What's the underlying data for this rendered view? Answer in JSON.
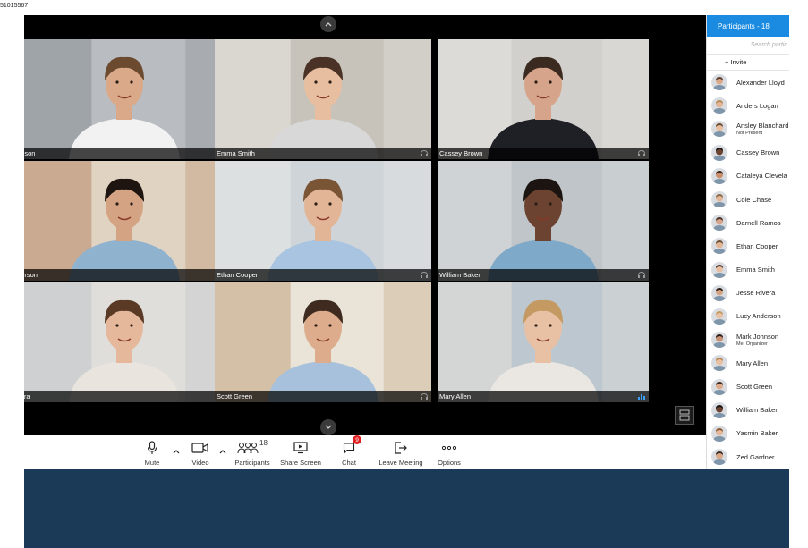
{
  "screen_id": "51015567",
  "tiles": [
    {
      "name": "nnson",
      "skin": "#d9a98a",
      "hair": "#6b4a30",
      "shirt": "#f2f2f2",
      "bg": "#8a8f96",
      "bg2": "#b9bcc0",
      "audio": true
    },
    {
      "name": "Emma Smith",
      "skin": "#e8bea0",
      "hair": "#4a3326",
      "shirt": "#d8d8d8",
      "bg": "#e9e6e1",
      "bg2": "#c7c3bb",
      "audio": false
    },
    {
      "name": "Cassey Brown",
      "skin": "#d6a48a",
      "hair": "#3b2a20",
      "shirt": "#1f1f26",
      "bg": "#e6e4e1",
      "bg2": "#d2d0cc",
      "audio": false
    },
    {
      "name": "derson",
      "skin": "#d4a384",
      "hair": "#1e1510",
      "shirt": "#8fb2cf",
      "bg": "#b88a6a",
      "bg2": "#e1d3c1",
      "audio": false
    },
    {
      "name": "Ethan Cooper",
      "skin": "#e2b597",
      "hair": "#7a5535",
      "shirt": "#a9c4e0",
      "bg": "#e8e9ea",
      "bg2": "#cfd4d8",
      "audio": false
    },
    {
      "name": "William Baker",
      "skin": "#6b4330",
      "hair": "#1b1411",
      "shirt": "#7fa9c9",
      "bg": "#dcdfe0",
      "bg2": "#bfc5c8",
      "audio": false
    },
    {
      "name": "vera",
      "skin": "#e5b89b",
      "hair": "#5a3a25",
      "shirt": "#e9e4dd",
      "bg": "#bfc4c8",
      "bg2": "#e0dedb",
      "audio": false
    },
    {
      "name": "Scott Green",
      "skin": "#dcac8c",
      "hair": "#3e2a1e",
      "shirt": "#a7c1dc",
      "bg": "#c2a37f",
      "bg2": "#e9e3d8",
      "audio": false
    },
    {
      "name": "Mary Allen",
      "skin": "#e8c1a4",
      "hair": "#c49a62",
      "shirt": "#eae6e1",
      "bg": "#e7e2db",
      "bg2": "#bcc7cf",
      "audio": true
    }
  ],
  "toolbar": {
    "mute": "Mute",
    "video": "Video",
    "participants": "Participants",
    "participants_count": "18",
    "share_screen": "Share Screen",
    "chat": "Chat",
    "chat_badge": "9",
    "leave": "Leave Meeting",
    "options": "Options"
  },
  "panel": {
    "title": "Participants - 18",
    "search_placeholder": "Search partic",
    "invite": "+ Invite",
    "participants": [
      {
        "name": "Alexander Lloyd",
        "sub": "",
        "skin": "#d9a98a",
        "hair": "#5a3e2b"
      },
      {
        "name": "Anders Logan",
        "sub": "",
        "skin": "#e2b597",
        "hair": "#b58a5a"
      },
      {
        "name": "Ansley Blanchard",
        "sub": "Not Present",
        "skin": "#e8bea0",
        "hair": "#6b4a30"
      },
      {
        "name": "Cassey Brown",
        "sub": "",
        "skin": "#6b4330",
        "hair": "#1b1411"
      },
      {
        "name": "Cataleya Clevela",
        "sub": "",
        "skin": "#c98e6c",
        "hair": "#3a2418"
      },
      {
        "name": "Cole Chase",
        "sub": "",
        "skin": "#e2b597",
        "hair": "#8a6a45"
      },
      {
        "name": "Darnell Ramos",
        "sub": "",
        "skin": "#d6a48a",
        "hair": "#4a3326"
      },
      {
        "name": "Ethan Cooper",
        "sub": "",
        "skin": "#e2b597",
        "hair": "#6e4f32"
      },
      {
        "name": "Emma Smith",
        "sub": "",
        "skin": "#e8bea0",
        "hair": "#4a3326"
      },
      {
        "name": "Jesse Rivera",
        "sub": "",
        "skin": "#d4a384",
        "hair": "#2a1d16"
      },
      {
        "name": "Lucy Anderson",
        "sub": "",
        "skin": "#e8c1a4",
        "hair": "#c49a62"
      },
      {
        "name": "Mark Johnson",
        "sub": "Me, Organizer",
        "skin": "#c99274",
        "hair": "#2a1d16"
      },
      {
        "name": "Mary Allen",
        "sub": "",
        "skin": "#e8c1a4",
        "hair": "#b88450"
      },
      {
        "name": "Scott Green",
        "sub": "",
        "skin": "#dcac8c",
        "hair": "#3e2a1e"
      },
      {
        "name": "William Baker",
        "sub": "",
        "skin": "#6b4330",
        "hair": "#1b1411"
      },
      {
        "name": "Yasmin Baker",
        "sub": "",
        "skin": "#e5b89b",
        "hair": "#8a5a36"
      },
      {
        "name": "Zed Gardner",
        "sub": "",
        "skin": "#d9a98a",
        "hair": "#3b2a20"
      }
    ]
  },
  "colors": {
    "panel_header": "#1a8be0",
    "badge": "#e02020",
    "bottom_bar": "#1b3a57",
    "audio_indicator": "#3aa0ff"
  }
}
